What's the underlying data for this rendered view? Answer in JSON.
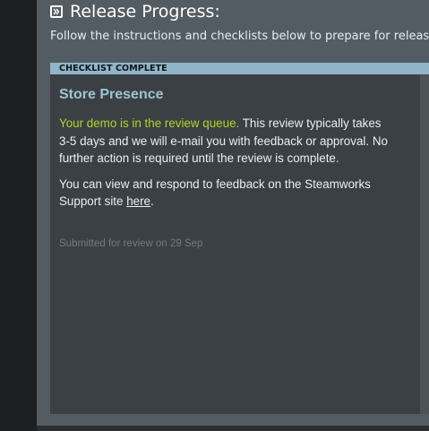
{
  "header": {
    "icon": "double-chevron-right-icon",
    "title": "Release Progress:"
  },
  "subtitle": "Follow the instructions and checklists below to prepare for release",
  "card": {
    "banner": "CHECKLIST COMPLETE",
    "title": "Store Presence",
    "status_highlight": "Your demo is in the review queue.",
    "status_text": " This review typically takes 3-5 days and we will e-mail you with feedback or approval. No further action is required until the review is complete.",
    "feedback_text": "You can view and respond to feedback on the Steamworks Support site ",
    "feedback_link": "here",
    "feedback_end": ".",
    "submitted": "Submitted for review on 29 Sep"
  },
  "colors": {
    "accent_green": "#b7d227",
    "banner_blue": "#91b4c7",
    "title_blue": "#9fc3d7"
  }
}
